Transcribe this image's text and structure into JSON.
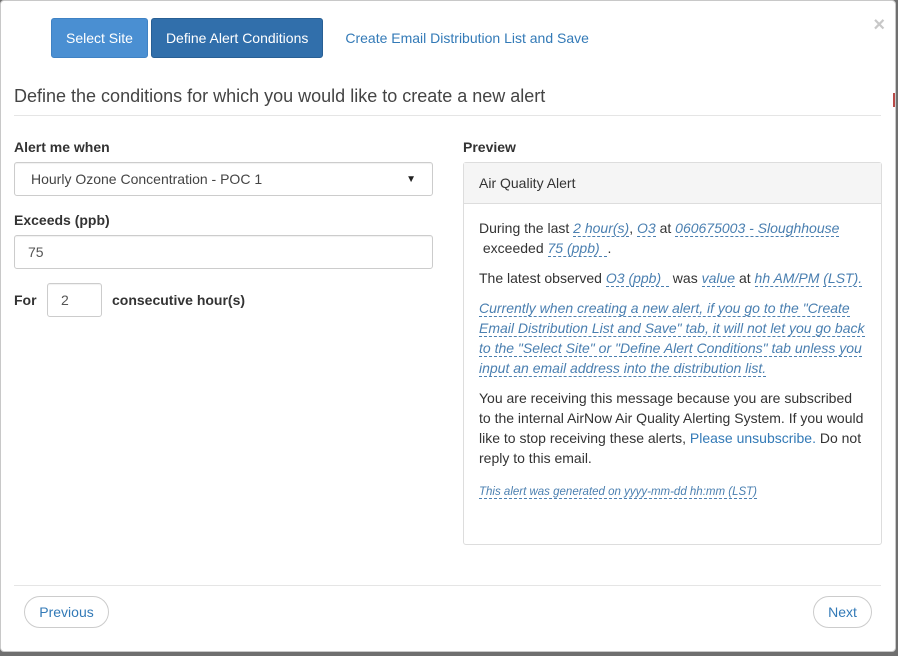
{
  "tabs": [
    {
      "label": "Select Site"
    },
    {
      "label": "Define Alert Conditions"
    },
    {
      "label": "Create Email Distribution List and Save"
    }
  ],
  "close_glyph": "×",
  "heading": "Define the conditions for which you would like to create a new alert",
  "form": {
    "alert_label": "Alert me when",
    "alert_value": "Hourly Ozone Concentration - POC 1",
    "exceeds_label": "Exceeds (ppb)",
    "exceeds_value": "75",
    "for_label": "For",
    "for_value": "2",
    "consecutive_label": "consecutive hour(s)"
  },
  "preview": {
    "label": "Preview",
    "panel_title": "Air Quality Alert",
    "line1": {
      "t1": "During the last",
      "hours": "2",
      "hours_unit": "hour(s)",
      "comma": ",",
      "param": "O3",
      "at": "at",
      "site": "060675003 - Sloughhouse",
      "exceeded": "exceeded",
      "threshold": "75",
      "threshold_unit": "(ppb)",
      "period": "."
    },
    "line2": {
      "t1": "The latest observed",
      "param": "O3",
      "unit": "(ppb)",
      "was": "was",
      "value": "value",
      "at": "at",
      "time": "hh AM/PM",
      "tz": "(LST)."
    },
    "note": "Currently when creating a new alert, if you go to the \"Create Email Distribution List and Save\" tab, it will not let you go back to the \"Select Site\" or \"Define Alert Conditions\" tab unless you input an email address into the distribution list.",
    "receiving_text": "You are receiving this message because you are subscribed to the internal AirNow Air Quality Alerting System. If you would like to stop receiving these alerts,",
    "unsubscribe_link": "Please unsubscribe.",
    "no_reply": "Do not reply to this email.",
    "generated": "This alert was generated on yyyy-mm-dd hh:mm (LST)"
  },
  "footer": {
    "previous": "Previous",
    "next": "Next"
  }
}
